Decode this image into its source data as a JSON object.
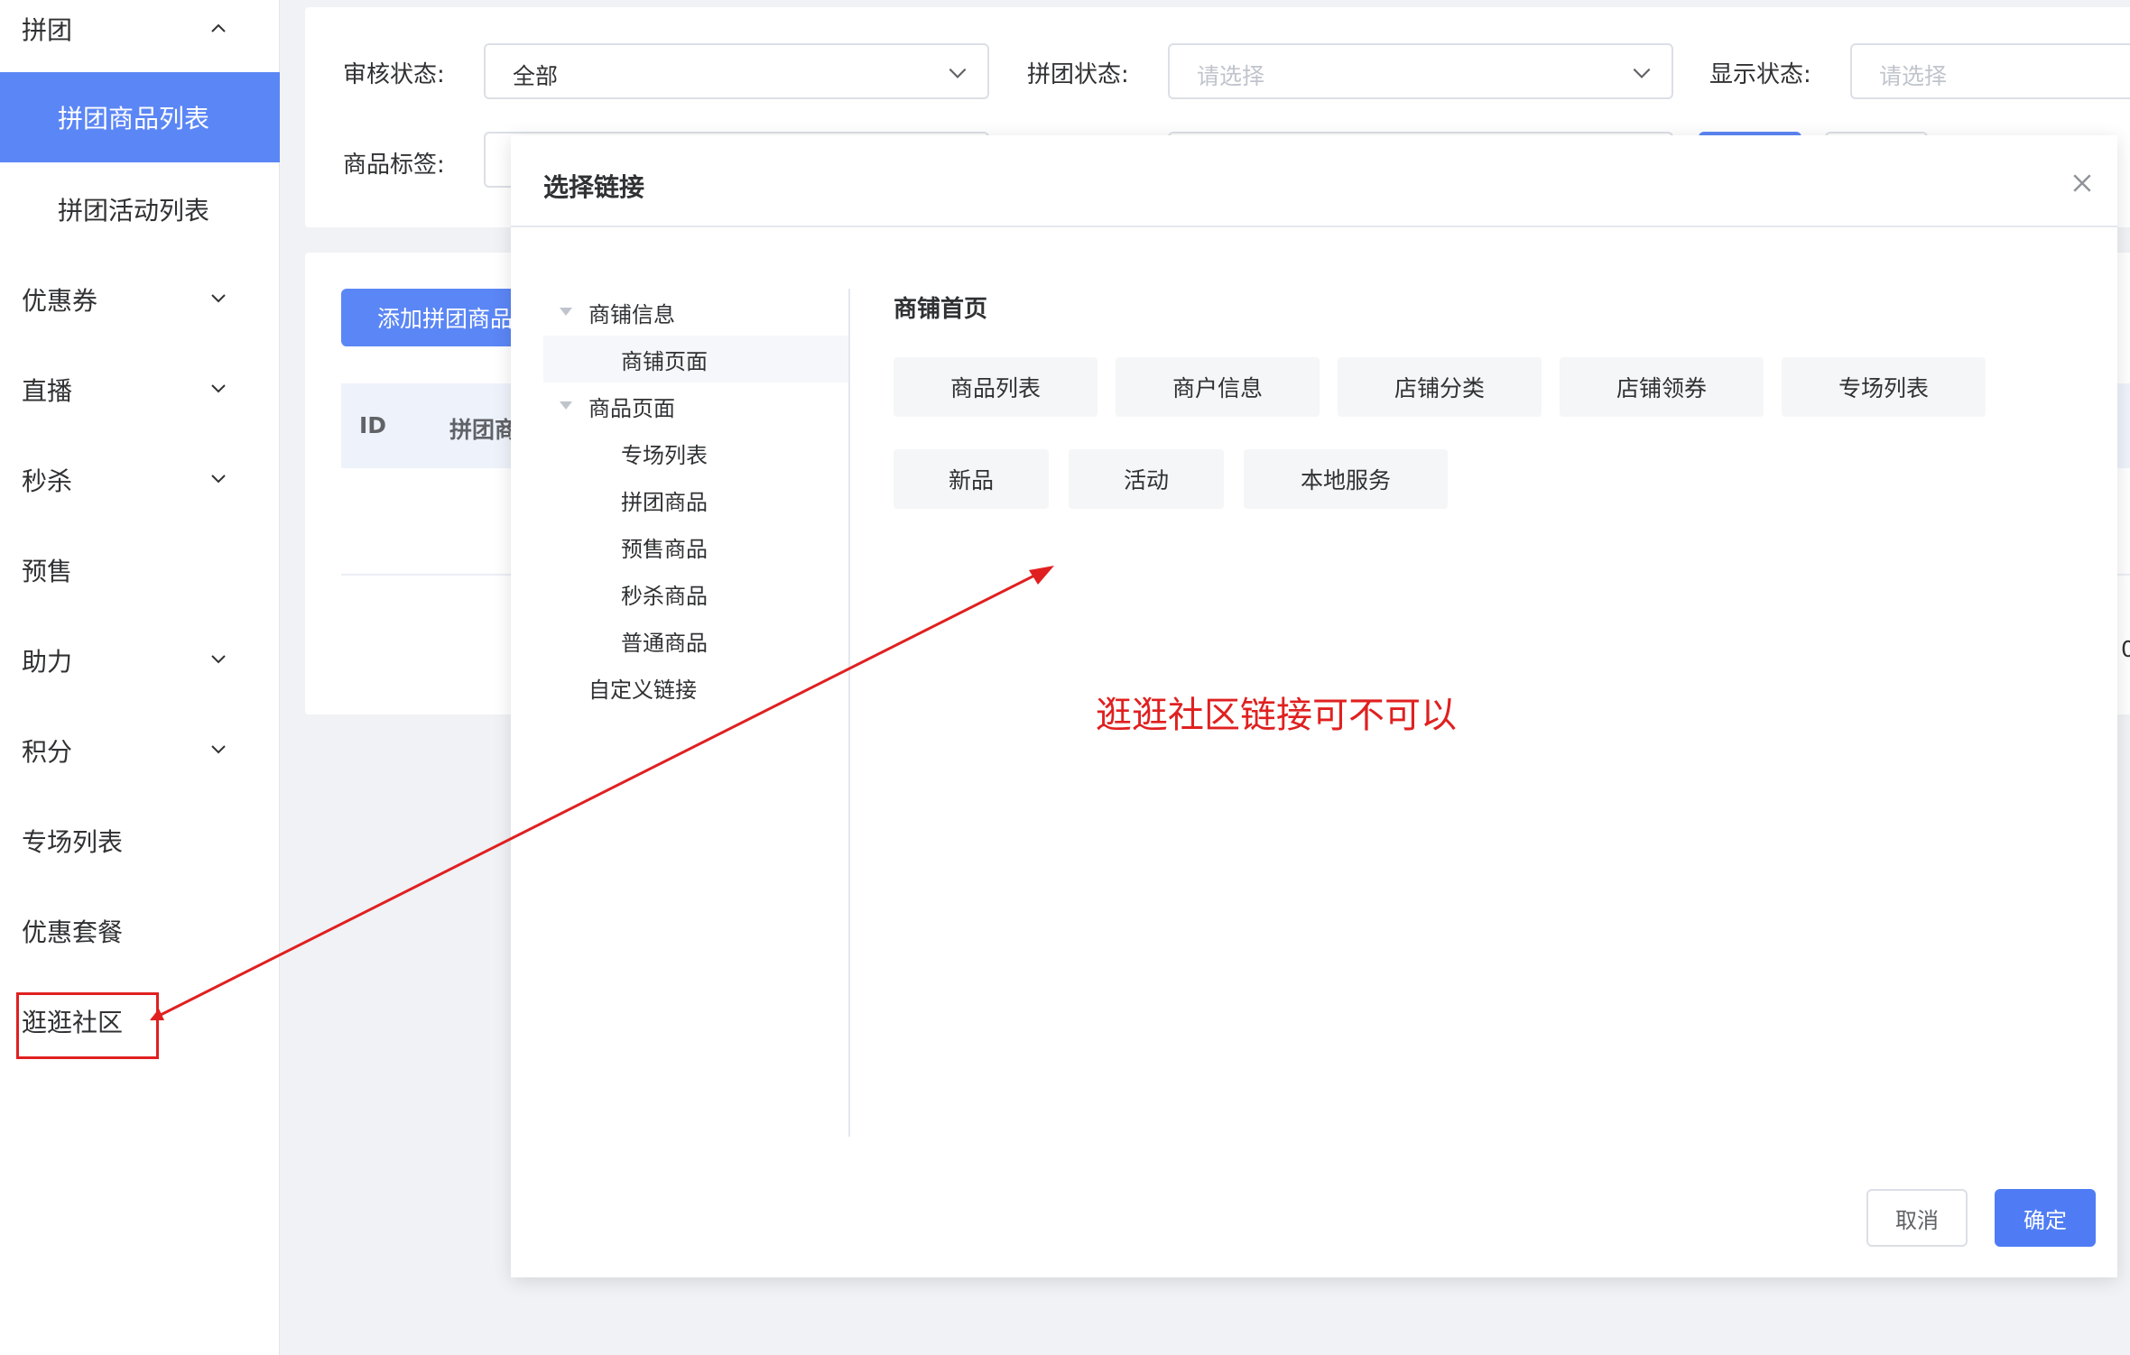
{
  "sidebar": {
    "items": [
      {
        "label": "拼团",
        "chevron": "up"
      },
      {
        "label": "拼团商品列表"
      },
      {
        "label": "拼团活动列表"
      },
      {
        "label": "优惠券",
        "chevron": "down"
      },
      {
        "label": "直播",
        "chevron": "down"
      },
      {
        "label": "秒杀",
        "chevron": "down"
      },
      {
        "label": "预售"
      },
      {
        "label": "助力",
        "chevron": "down"
      },
      {
        "label": "积分",
        "chevron": "down"
      },
      {
        "label": "专场列表"
      },
      {
        "label": "优惠套餐"
      },
      {
        "label": "逛逛社区"
      }
    ],
    "active_item": "拼团商品列表"
  },
  "filters": {
    "audit_status": {
      "label": "审核状态:",
      "value": "全部"
    },
    "group_status": {
      "label": "拼团状态:",
      "placeholder": "请选择"
    },
    "display_status": {
      "label": "显示状态:",
      "placeholder": "请选择"
    },
    "product_tag": {
      "label": "商品标签:"
    }
  },
  "table": {
    "add_button": "添加拼团商品",
    "headers": {
      "id": "ID",
      "name": "拼团商"
    },
    "edge_text": "0"
  },
  "dialog": {
    "title": "选择链接",
    "tree": [
      {
        "label": "商铺信息",
        "expanded": true
      },
      {
        "label": "商铺页面"
      },
      {
        "label": "商品页面",
        "expanded": true
      },
      {
        "label": "专场列表"
      },
      {
        "label": "拼团商品"
      },
      {
        "label": "预售商品"
      },
      {
        "label": "秒杀商品"
      },
      {
        "label": "普通商品"
      },
      {
        "label": "自定义链接"
      }
    ],
    "section_title": "商铺首页",
    "links_row1": [
      "商品列表",
      "商户信息",
      "店铺分类",
      "店铺领券",
      "专场列表"
    ],
    "links_row2": [
      "新品",
      "活动",
      "本地服务"
    ],
    "cancel_label": "取消",
    "confirm_label": "确定"
  },
  "annotation": {
    "text": "逛逛社区链接可不可以",
    "color": "#e02020"
  },
  "colors": {
    "primary": "#5b86f5",
    "annotation_red": "#e02020"
  }
}
